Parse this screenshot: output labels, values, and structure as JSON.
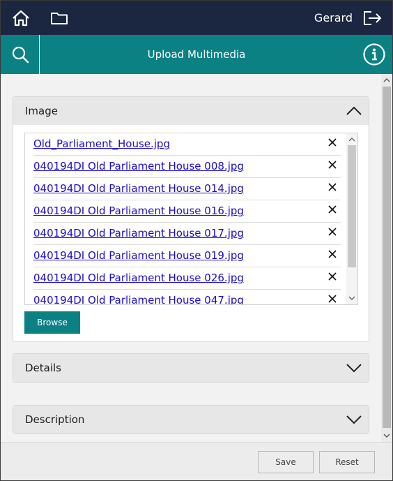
{
  "topbar": {
    "user_name": "Gerard",
    "icons": [
      "home-icon",
      "folder-icon",
      "logout-icon"
    ]
  },
  "header": {
    "title": "Upload Multimedia",
    "icons": [
      "search-icon",
      "info-icon"
    ]
  },
  "image_panel": {
    "label": "Image",
    "files": [
      "Old_Parliament_House.jpg",
      "040194DI Old Parliament House 008.jpg",
      "040194DI Old Parliament House 014.jpg",
      "040194DI Old Parliament House 016.jpg",
      "040194DI Old Parliament House 017.jpg",
      "040194DI Old Parliament House 019.jpg",
      "040194DI Old Parliament House 026.jpg",
      "040194DI Old Parliament House 047.jpg"
    ],
    "browse_label": "Browse"
  },
  "details_panel": {
    "label": "Details"
  },
  "description_panel": {
    "label": "Description"
  },
  "footer": {
    "save_label": "Save",
    "reset_label": "Reset"
  },
  "colors": {
    "topbar_bg": "#1b2741",
    "accent": "#0b8184",
    "link": "#1a0dcc"
  }
}
